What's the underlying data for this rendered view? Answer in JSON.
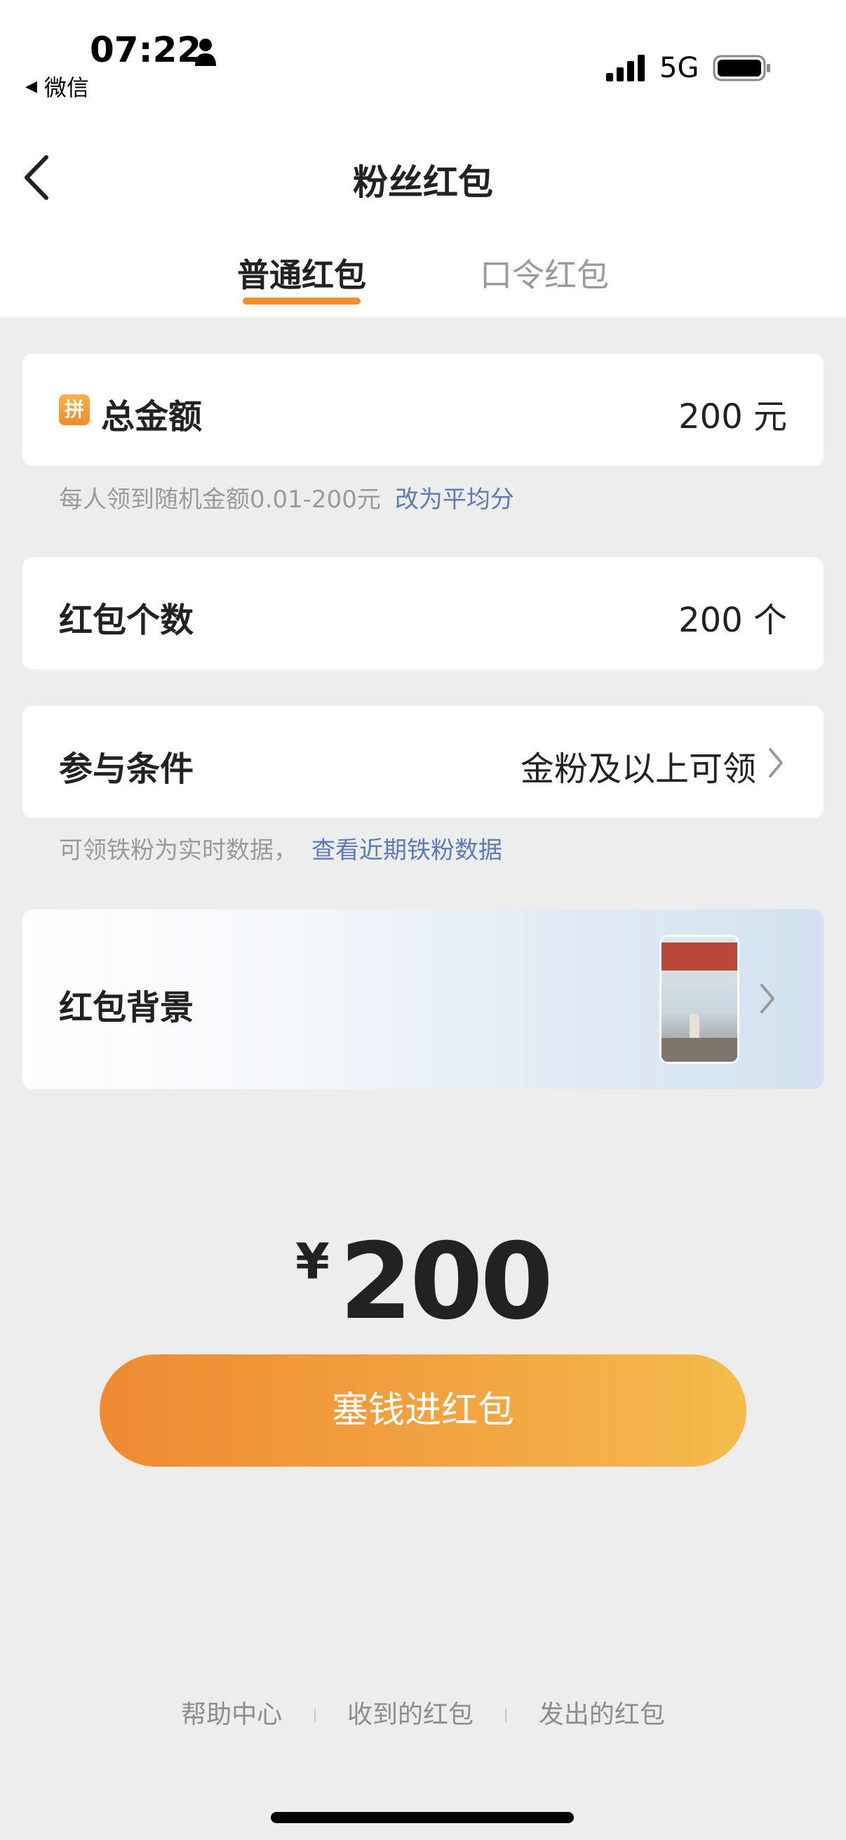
{
  "status_bar": {
    "time": "07:22",
    "back_app": "微信",
    "network": "5G"
  },
  "nav": {
    "title": "粉丝红包"
  },
  "tabs": [
    {
      "label": "普通红包",
      "active": true
    },
    {
      "label": "口令红包",
      "active": false
    }
  ],
  "total_amount": {
    "badge": "拼",
    "label": "总金额",
    "value": "200 元",
    "hint": "每人领到随机金额0.01-200元",
    "hint_link": "改为平均分"
  },
  "count": {
    "label": "红包个数",
    "value": "200 个"
  },
  "condition": {
    "label": "参与条件",
    "value": "金粉及以上可领",
    "hint": "可领铁粉为实时数据，",
    "hint_link": "查看近期铁粉数据"
  },
  "background": {
    "label": "红包背景"
  },
  "summary": {
    "currency": "¥",
    "amount": "200"
  },
  "pay_button": {
    "label": "塞钱进红包"
  },
  "footer": {
    "links": [
      "帮助中心",
      "收到的红包",
      "发出的红包"
    ]
  },
  "colors": {
    "accent": "#f0902e",
    "link": "#5b7db1",
    "page_bg": "#ededed"
  }
}
